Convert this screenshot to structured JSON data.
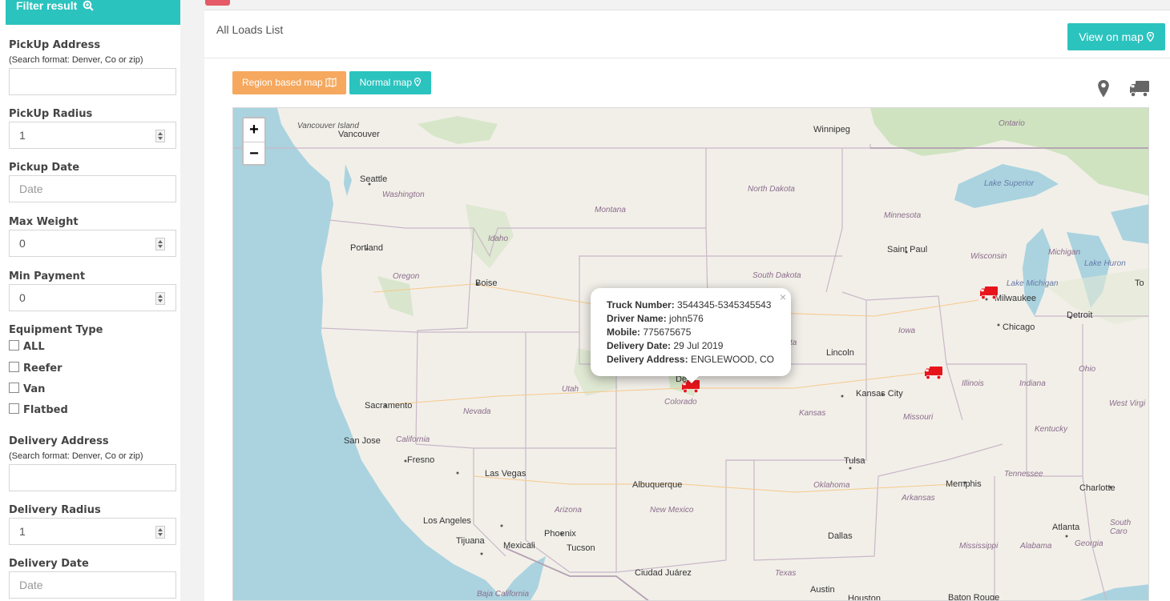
{
  "sidebar": {
    "title": "Filter result",
    "pickup_address_label": "PickUp Address",
    "pickup_address_hint": "(Search format: Denver, Co or zip)",
    "pickup_address_value": "",
    "pickup_radius_label": "PickUp Radius",
    "pickup_radius_value": "1",
    "pickup_date_label": "Pickup Date",
    "pickup_date_placeholder": "Date",
    "max_weight_label": "Max Weight",
    "max_weight_value": "0",
    "min_payment_label": "Min Payment",
    "min_payment_value": "0",
    "equipment_label": "Equipment Type",
    "equipment_options": [
      "ALL",
      "Reefer",
      "Van",
      "Flatbed"
    ],
    "delivery_address_label": "Delivery Address",
    "delivery_address_hint": "(Search format: Denver, Co or zip)",
    "delivery_address_value": "",
    "delivery_radius_label": "Delivery Radius",
    "delivery_radius_value": "1",
    "delivery_date_label": "Delivery Date",
    "delivery_date_placeholder": "Date"
  },
  "header": {
    "title": "All Loads List",
    "view_on_map_label": "View on map"
  },
  "map_toolbar": {
    "region_map_label": "Region based map",
    "normal_map_label": "Normal map"
  },
  "map": {
    "zoom_in": "+",
    "zoom_out": "−",
    "labels": {
      "vancouver_island": "Vancouver Island",
      "vancouver": "Vancouver",
      "winnipeg": "Winnipeg",
      "ontario": "Ontario",
      "seattle": "Seattle",
      "washington": "Washington",
      "north_dakota": "North Dakota",
      "montana": "Montana",
      "minnesota": "Minnesota",
      "lake_superior": "Lake Superior",
      "idaho": "Idaho",
      "portland": "Portland",
      "saint_paul": "Saint Paul",
      "wisconsin": "Wisconsin",
      "michigan": "Michigan",
      "lake_huron": "Lake Huron",
      "oregon": "Oregon",
      "boise": "Boise",
      "south_dakota": "South Dakota",
      "lake_michigan": "Lake Michigan",
      "to": "To",
      "milwaukee": "Milwaukee",
      "detroit": "Detroit",
      "chicago": "Chicago",
      "iowa": "Iowa",
      "lincoln": "Lincoln",
      "nebraska_partial": "ta",
      "utah": "Utah",
      "denver_partial": "De",
      "illinois": "Illinois",
      "indiana": "Indiana",
      "ohio": "Ohio",
      "kansas_city": "Kansas City",
      "sacramento": "Sacramento",
      "nevada": "Nevada",
      "colorado": "Colorado",
      "west_virginia": "West Virgi",
      "kansas": "Kansas",
      "missouri": "Missouri",
      "san_jose": "San Jose",
      "california": "California",
      "kentucky": "Kentucky",
      "fresno": "Fresno",
      "tulsa": "Tulsa",
      "las_vegas": "Las Vegas",
      "tennessee": "Tennessee",
      "albuquerque": "Albuquerque",
      "memphis": "Memphis",
      "charlotte": "Charlotte",
      "oklahoma": "Oklahoma",
      "arizona": "Arizona",
      "new_mexico": "New Mexico",
      "arkansas": "Arkansas",
      "south_carolina": "South Caro",
      "los_angeles": "Los Angeles",
      "phoenix": "Phoenix",
      "atlanta": "Atlanta",
      "tijuana": "Tijuana",
      "mexicali": "Mexicali",
      "tucson": "Tucson",
      "dallas": "Dallas",
      "mississippi": "Mississippi",
      "alabama": "Alabama",
      "georgia": "Georgia",
      "ciudad_juarez": "Ciudad Juárez",
      "texas": "Texas",
      "austin": "Austin",
      "houston": "Houston",
      "baton_rouge": "Baton Rouge",
      "baja_california": "Baja California"
    }
  },
  "popup": {
    "truck_number_label": "Truck Number:",
    "truck_number_value": "3544345-5345345543",
    "driver_name_label": "Driver Name:",
    "driver_name_value": "john576",
    "mobile_label": "Mobile:",
    "mobile_value": "775675675",
    "delivery_date_label": "Delivery Date:",
    "delivery_date_value": "29 Jul 2019",
    "delivery_address_label": "Delivery Address:",
    "delivery_address_value": "ENGLEWOOD, CO",
    "close": "×"
  },
  "icons": {
    "filter": "search-plus-icon",
    "view_map": "map-marker-icon",
    "region_map": "map-icon",
    "normal_map": "map-marker-icon",
    "marker_tool": "map-marker-icon",
    "truck_tool": "truck-icon"
  },
  "colors": {
    "accent": "#2bc3be",
    "orange": "#f5a85e",
    "danger": "#e55a66",
    "truck": "#e8141c"
  }
}
